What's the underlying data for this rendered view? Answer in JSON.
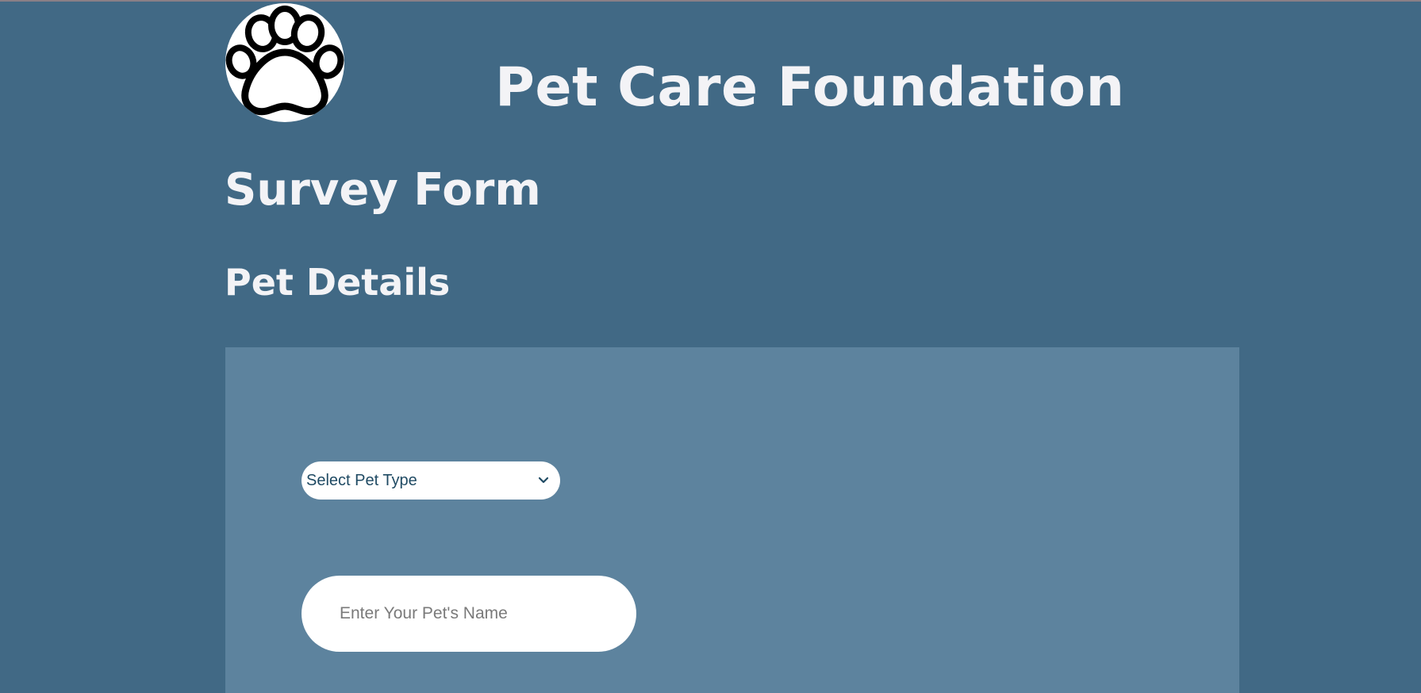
{
  "header": {
    "logo_icon": "paw-print-icon",
    "site_title": "Pet Care Foundation"
  },
  "page": {
    "survey_title": "Survey Form",
    "section_title": "Pet Details"
  },
  "form": {
    "pet_type": {
      "selected": "Select Pet Type",
      "icon": "chevron-down-icon"
    },
    "pet_name": {
      "value": "",
      "placeholder": "Enter Your Pet's Name"
    }
  },
  "colors": {
    "page_background": "#416985",
    "panel_background": "#5d839e",
    "heading_text": "#f3f3f6",
    "select_text": "#1f4a63"
  }
}
